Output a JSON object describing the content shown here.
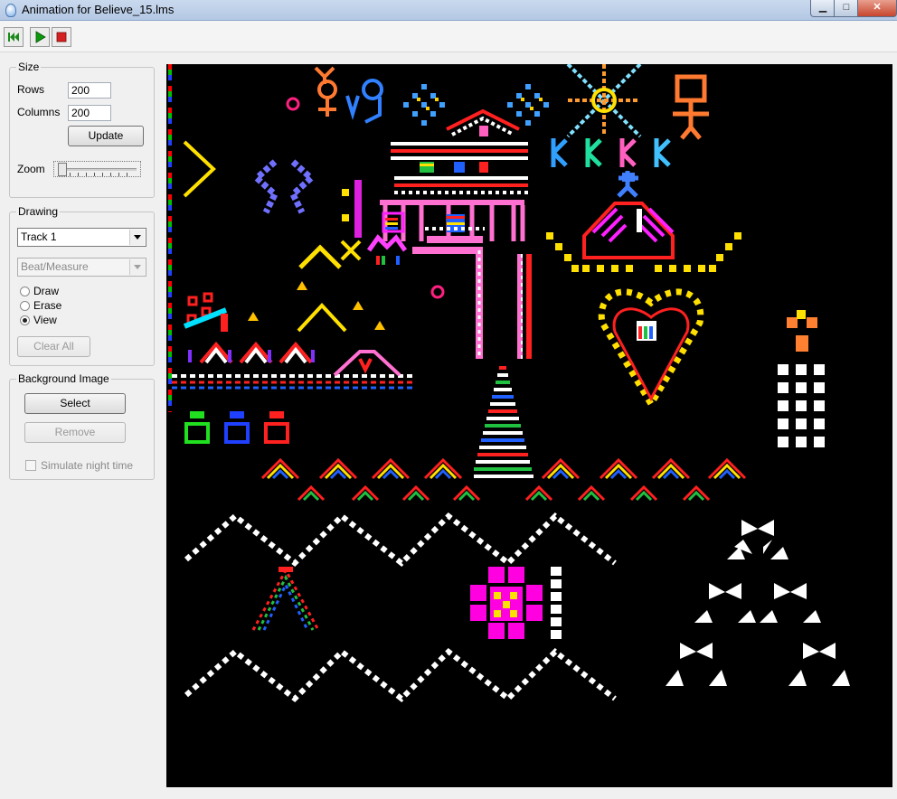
{
  "window": {
    "title": "Animation for Believe_15.lms",
    "minimize_glyph": "▁",
    "maximize_glyph": "□",
    "close_glyph": "✕"
  },
  "toolbar": {
    "rewind_icon": "rewind-icon",
    "play_icon": "play-icon",
    "stop_icon": "stop-icon",
    "colors": {
      "play": "#0a9a0a",
      "stop": "#d42020",
      "rewind": "#1a8a1a"
    }
  },
  "size": {
    "legend": "Size",
    "rows_label": "Rows",
    "rows_value": "200",
    "columns_label": "Columns",
    "columns_value": "200",
    "update_button": "Update",
    "zoom_label": "Zoom"
  },
  "drawing": {
    "legend": "Drawing",
    "track_selected": "Track 1",
    "grid_selected": "Beat/Measure",
    "modes": [
      {
        "label": "Draw",
        "selected": false
      },
      {
        "label": "Erase",
        "selected": false
      },
      {
        "label": "View",
        "selected": true
      }
    ],
    "clear_all_button": "Clear All"
  },
  "background_image": {
    "legend": "Background Image",
    "select_button": "Select",
    "remove_button": "Remove",
    "simulate_night_label": "Simulate night time",
    "simulate_night_checked": false
  },
  "canvas": {
    "background": "#000000"
  }
}
